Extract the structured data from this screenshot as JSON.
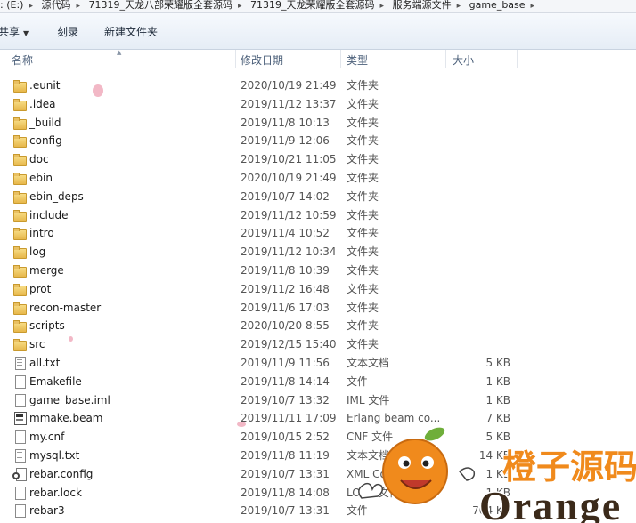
{
  "address": {
    "segments": [
      ": (E:)",
      "源代码",
      "71319_天龙八部荣耀版全套源码",
      "71319_天龙荣耀版全套源码",
      "服务端源文件",
      "game_base"
    ]
  },
  "toolbar": {
    "share_label": "共享",
    "burn_label": "刻录",
    "new_folder_label": "新建文件夹"
  },
  "columns": {
    "name": "名称",
    "date": "修改日期",
    "type": "类型",
    "size": "大小"
  },
  "files": [
    {
      "name": ".eunit",
      "date": "2020/10/19 21:49",
      "type": "文件夹",
      "size": "",
      "icon": "folder-icon"
    },
    {
      "name": ".idea",
      "date": "2019/11/12 13:37",
      "type": "文件夹",
      "size": "",
      "icon": "folder-icon"
    },
    {
      "name": "_build",
      "date": "2019/11/8 10:13",
      "type": "文件夹",
      "size": "",
      "icon": "folder-icon"
    },
    {
      "name": "config",
      "date": "2019/11/9 12:06",
      "type": "文件夹",
      "size": "",
      "icon": "folder-icon"
    },
    {
      "name": "doc",
      "date": "2019/10/21 11:05",
      "type": "文件夹",
      "size": "",
      "icon": "folder-icon"
    },
    {
      "name": "ebin",
      "date": "2020/10/19 21:49",
      "type": "文件夹",
      "size": "",
      "icon": "folder-icon"
    },
    {
      "name": "ebin_deps",
      "date": "2019/10/7 14:02",
      "type": "文件夹",
      "size": "",
      "icon": "folder-icon"
    },
    {
      "name": "include",
      "date": "2019/11/12 10:59",
      "type": "文件夹",
      "size": "",
      "icon": "folder-icon"
    },
    {
      "name": "intro",
      "date": "2019/11/4 10:52",
      "type": "文件夹",
      "size": "",
      "icon": "folder-icon"
    },
    {
      "name": "log",
      "date": "2019/11/12 10:34",
      "type": "文件夹",
      "size": "",
      "icon": "folder-icon"
    },
    {
      "name": "merge",
      "date": "2019/11/8 10:39",
      "type": "文件夹",
      "size": "",
      "icon": "folder-icon"
    },
    {
      "name": "prot",
      "date": "2019/11/2 16:48",
      "type": "文件夹",
      "size": "",
      "icon": "folder-icon"
    },
    {
      "name": "recon-master",
      "date": "2019/11/6 17:03",
      "type": "文件夹",
      "size": "",
      "icon": "folder-icon"
    },
    {
      "name": "scripts",
      "date": "2020/10/20 8:55",
      "type": "文件夹",
      "size": "",
      "icon": "folder-icon"
    },
    {
      "name": "src",
      "date": "2019/12/15 15:40",
      "type": "文件夹",
      "size": "",
      "icon": "folder-icon"
    },
    {
      "name": "all.txt",
      "date": "2019/11/9 11:56",
      "type": "文本文档",
      "size": "5 KB",
      "icon": "text-file-icon"
    },
    {
      "name": "Emakefile",
      "date": "2019/11/8 14:14",
      "type": "文件",
      "size": "1 KB",
      "icon": "file-icon"
    },
    {
      "name": "game_base.iml",
      "date": "2019/10/7 13:32",
      "type": "IML 文件",
      "size": "1 KB",
      "icon": "file-icon"
    },
    {
      "name": "mmake.beam",
      "date": "2019/11/11 17:09",
      "type": "Erlang beam co...",
      "size": "7 KB",
      "icon": "beam-file-icon"
    },
    {
      "name": "my.cnf",
      "date": "2019/10/15 2:52",
      "type": "CNF 文件",
      "size": "5 KB",
      "icon": "file-icon"
    },
    {
      "name": "mysql.txt",
      "date": "2019/11/8 11:19",
      "type": "文本文档",
      "size": "14 KB",
      "icon": "text-file-icon"
    },
    {
      "name": "rebar.config",
      "date": "2019/10/7 13:31",
      "type": "XML Configurati...",
      "size": "1 KB",
      "icon": "config-file-icon"
    },
    {
      "name": "rebar.lock",
      "date": "2019/11/8 14:08",
      "type": "LOCK 文件",
      "size": "1 KB",
      "icon": "file-icon"
    },
    {
      "name": "rebar3",
      "date": "2019/10/7 13:31",
      "type": "文件",
      "size": "704 KB",
      "icon": "file-icon"
    }
  ],
  "watermark": {
    "cn_text": "橙子源码",
    "en_text": "Orange",
    "colors": {
      "orange": "#f08a1c",
      "leaf": "#6fae3a",
      "text_dark": "#3b2a1a"
    }
  }
}
